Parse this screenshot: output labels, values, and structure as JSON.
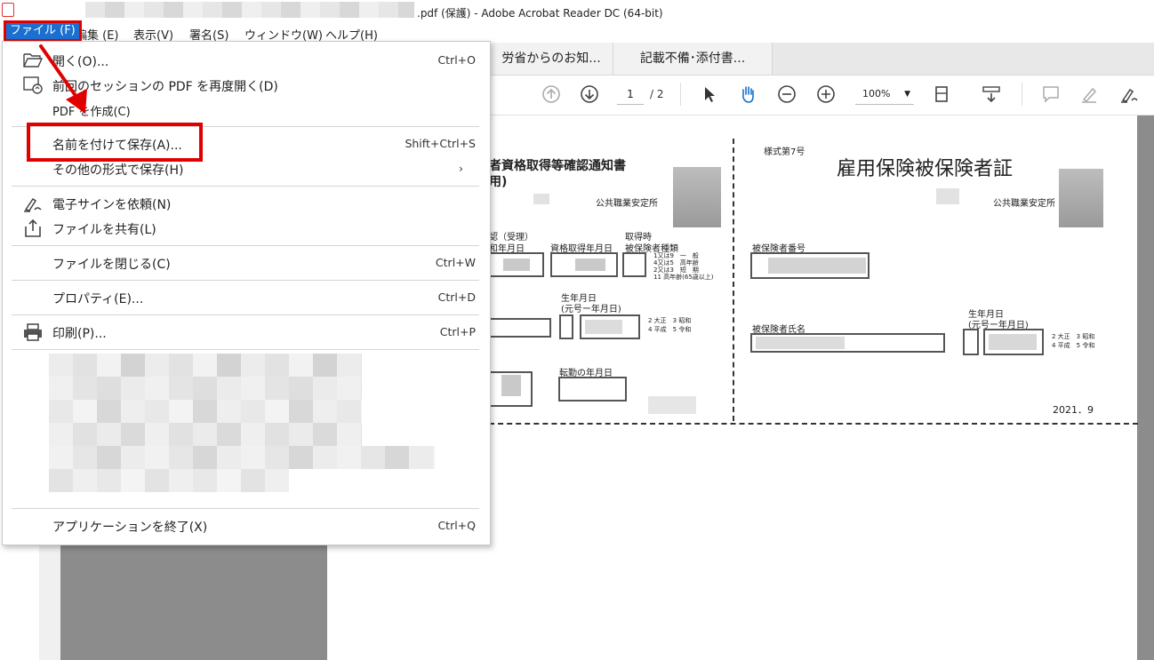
{
  "window": {
    "title": ".pdf (保護) - Adobe Acrobat Reader DC (64-bit)"
  },
  "menubar": {
    "file": "ファイル (F)",
    "edit": "編集 (E)",
    "view": "表示(V)",
    "sign": "署名(S)",
    "window": "ウィンドウ(W)",
    "help": "ヘルプ(H)"
  },
  "tabs": [
    {
      "label": "労省からのお知..."
    },
    {
      "label": "記載不備･添付書..."
    }
  ],
  "toolbar": {
    "page_current": "1",
    "page_total": "/ 2",
    "zoom": "100%"
  },
  "file_menu": {
    "items": [
      {
        "label": "開く(O)...",
        "shortcut": "Ctrl+O",
        "icon": "folder-open-icon"
      },
      {
        "label": "前回のセッションの PDF を再度開く(D)",
        "shortcut": "",
        "icon": "reopen-session-icon"
      },
      {
        "label": "PDF を作成(C)",
        "shortcut": "",
        "icon": ""
      },
      {
        "label": "名前を付けて保存(A)...",
        "shortcut": "Shift+Ctrl+S",
        "icon": ""
      },
      {
        "label": "その他の形式で保存(H)",
        "shortcut": "›",
        "icon": ""
      },
      {
        "label": "電子サインを依頼(N)",
        "shortcut": "",
        "icon": "request-signature-icon"
      },
      {
        "label": "ファイルを共有(L)",
        "shortcut": "",
        "icon": "share-icon"
      },
      {
        "label": "ファイルを閉じる(C)",
        "shortcut": "Ctrl+W",
        "icon": ""
      },
      {
        "label": "プロパティ(E)...",
        "shortcut": "Ctrl+D",
        "icon": ""
      },
      {
        "label": "印刷(P)...",
        "shortcut": "Ctrl+P",
        "icon": "printer-icon"
      },
      {
        "label": "アプリケーションを終了(X)",
        "shortcut": "Ctrl+Q",
        "icon": ""
      }
    ]
  },
  "document": {
    "left_form": {
      "title": "者資格取得等確認通知書",
      "subtitle": "用)",
      "office": "公共職業安定所",
      "col1": "認（受理）",
      "col1b": "和年月日",
      "col2": "資格取得年月日",
      "col3a": "取得時",
      "col3b": "被保険者種類",
      "types": "1又は9　一　般\n4又は5　高年齢\n2又は3　短　期\n11 高年齢(65歳以上)",
      "birth_label": "生年月日",
      "birth_sub": "(元号ー年月日)",
      "era": "2 大正　3 昭和\n4 平成　5 令和",
      "transfer_date": "転勤の年月日"
    },
    "right_form": {
      "form_no": "様式第7号",
      "title": "雇用保険被保険者証",
      "office": "公共職業安定所",
      "insured_number": "被保険者番号",
      "insured_name": "被保険者氏名",
      "birth_label": "生年月日",
      "birth_sub": "(元号ー年月日)",
      "era": "2 大正　3 昭和\n4 平成　5 令和",
      "date": "2021．9"
    }
  },
  "colors": {
    "menu_highlight": "#1a6fd0",
    "annotation_red": "#e00000"
  }
}
